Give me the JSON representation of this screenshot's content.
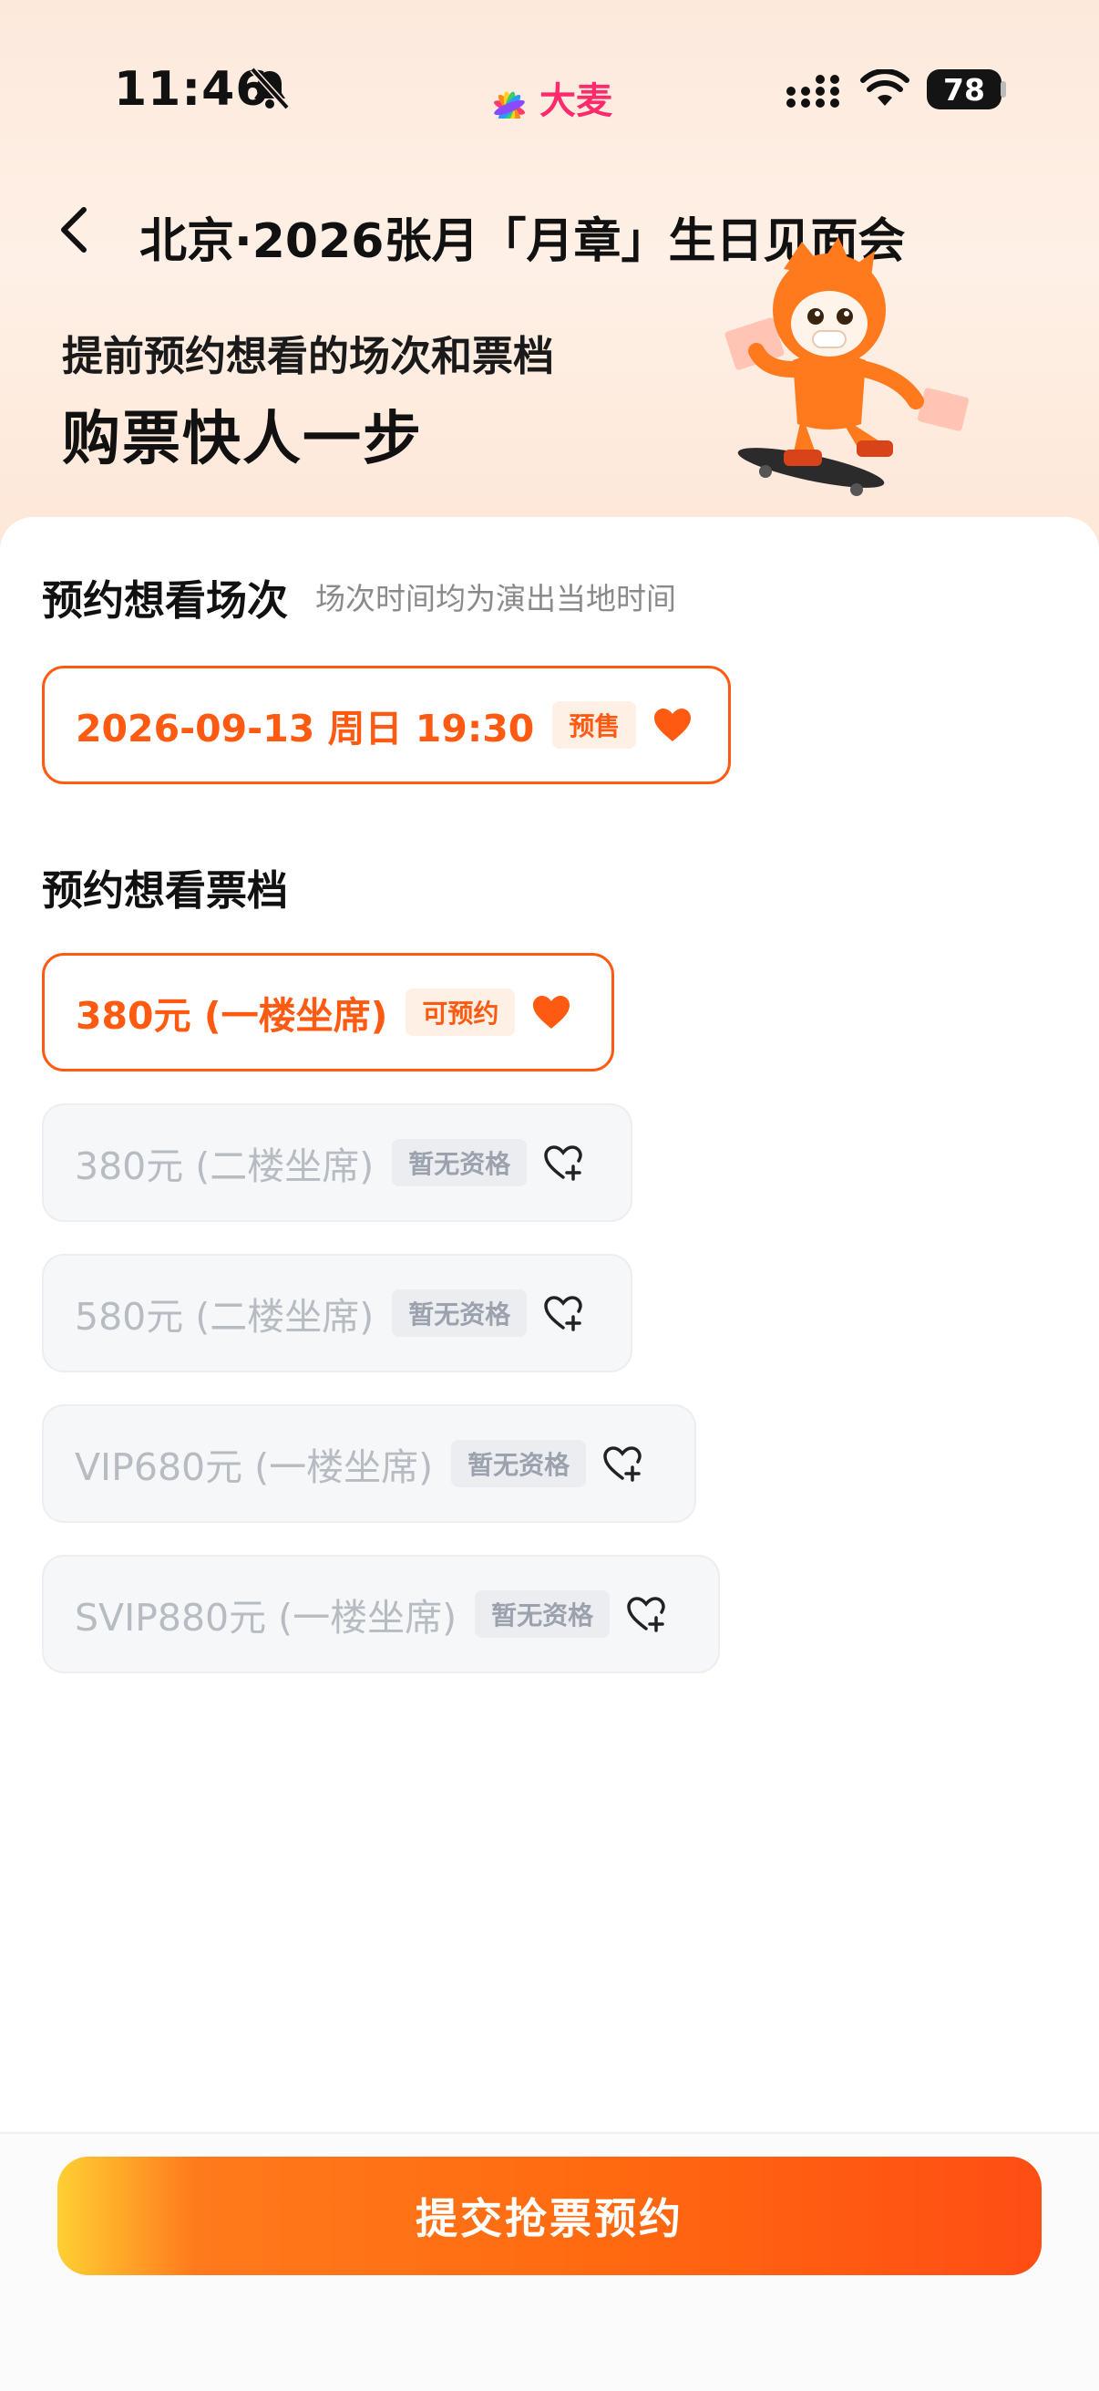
{
  "status": {
    "time": "11:46",
    "battery": "78",
    "app_brand": "大麦"
  },
  "header": {
    "title": "北京·2026张月「月章」生日见面会",
    "promo_line1": "提前预约想看的场次和票档",
    "promo_line2": "购票快人一步"
  },
  "sessions": {
    "title": "预约想看场次",
    "hint": "场次时间均为演出当地时间",
    "items": [
      {
        "label": "2026-09-13 周日 19:30",
        "tag": "预售",
        "selected": true
      }
    ]
  },
  "tickets": {
    "title": "预约想看票档",
    "items": [
      {
        "label": "380元 (一楼坐席)",
        "tag": "可预约",
        "selected": true
      },
      {
        "label": "380元 (二楼坐席)",
        "tag": "暂无资格",
        "selected": false
      },
      {
        "label": "580元 (二楼坐席)",
        "tag": "暂无资格",
        "selected": false
      },
      {
        "label": "VIP680元 (一楼坐席)",
        "tag": "暂无资格",
        "selected": false
      },
      {
        "label": "SVIP880元 (一楼坐席)",
        "tag": "暂无资格",
        "selected": false
      }
    ]
  },
  "submit": {
    "label": "提交抢票预约"
  },
  "colors": {
    "accent": "#ff5a12",
    "disabled_text": "#b7bbc2",
    "brand_pink": "#ff2a6b"
  },
  "icons": {
    "back": "chevron-left-icon",
    "heart_selected": "heart-filled-icon",
    "heart_add": "heart-plus-icon",
    "mute": "bell-slash-icon"
  }
}
